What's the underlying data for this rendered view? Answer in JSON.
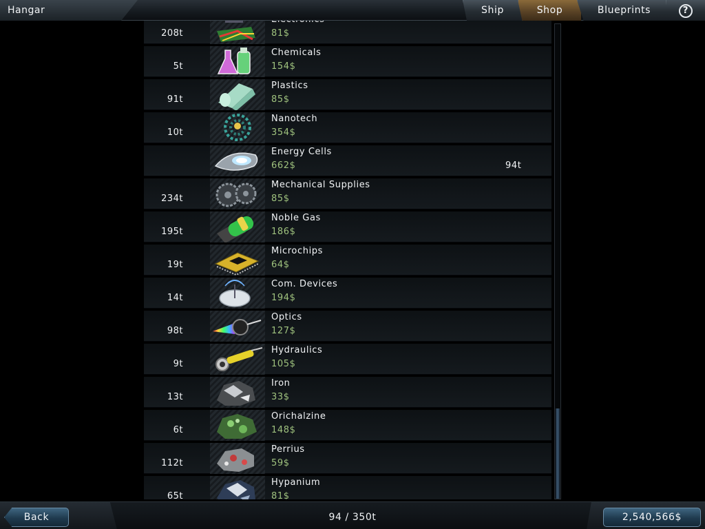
{
  "header": {
    "title": "Hangar",
    "tabs": [
      {
        "label": "Ship",
        "active": false
      },
      {
        "label": "Shop",
        "active": true
      },
      {
        "label": "Blueprints",
        "active": false
      }
    ],
    "help_icon": "?"
  },
  "items": [
    {
      "name": "Electronics",
      "price": "81$",
      "stock": "208t",
      "icon": "electronics-icon"
    },
    {
      "name": "Chemicals",
      "price": "154$",
      "stock": "5t",
      "icon": "chemicals-icon"
    },
    {
      "name": "Plastics",
      "price": "85$",
      "stock": "91t",
      "icon": "plastics-icon"
    },
    {
      "name": "Nanotech",
      "price": "354$",
      "stock": "10t",
      "icon": "nanotech-icon"
    },
    {
      "name": "Energy Cells",
      "price": "662$",
      "stock": "",
      "cargo": "94t",
      "icon": "energy-cells-icon"
    },
    {
      "name": "Mechanical Supplies",
      "price": "85$",
      "stock": "234t",
      "icon": "mechanical-supplies-icon"
    },
    {
      "name": "Noble Gas",
      "price": "186$",
      "stock": "195t",
      "icon": "noble-gas-icon"
    },
    {
      "name": "Microchips",
      "price": "64$",
      "stock": "19t",
      "icon": "microchips-icon"
    },
    {
      "name": "Com. Devices",
      "price": "194$",
      "stock": "14t",
      "icon": "com-devices-icon"
    },
    {
      "name": "Optics",
      "price": "127$",
      "stock": "98t",
      "icon": "optics-icon"
    },
    {
      "name": "Hydraulics",
      "price": "105$",
      "stock": "9t",
      "icon": "hydraulics-icon"
    },
    {
      "name": "Iron",
      "price": "33$",
      "stock": "13t",
      "icon": "iron-icon"
    },
    {
      "name": "Orichalzine",
      "price": "148$",
      "stock": "6t",
      "icon": "orichalzine-icon"
    },
    {
      "name": "Perrius",
      "price": "59$",
      "stock": "112t",
      "icon": "perrius-icon"
    },
    {
      "name": "Hypanium",
      "price": "81$",
      "stock": "65t",
      "icon": "hypanium-icon"
    }
  ],
  "scroll": {
    "fraction_visible": 0.19,
    "position": 1.0
  },
  "footer": {
    "back_label": "Back",
    "cargo_summary": "94 / 350t",
    "credits": "2,540,566$"
  },
  "colors": {
    "price": "#9fc27e",
    "active_tab": "#8a6a3a",
    "button": "#2c4d66"
  }
}
